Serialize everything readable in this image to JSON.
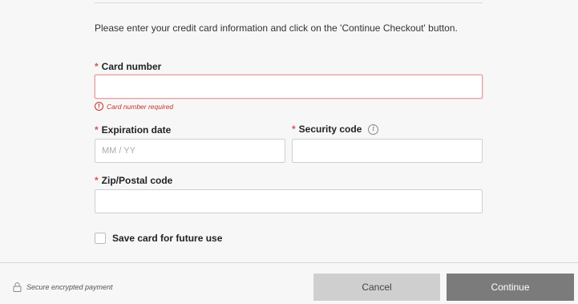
{
  "intro_text": "Please enter your credit card information and click on the 'Continue Checkout' button.",
  "required_marker": "*",
  "card_number": {
    "label": "Card number",
    "value": "",
    "error": "Card number required",
    "error_icon": "!"
  },
  "expiration": {
    "label": "Expiration date",
    "placeholder": "MM / YY",
    "value": ""
  },
  "security": {
    "label": "Security code",
    "info_icon": "i",
    "value": ""
  },
  "zip": {
    "label": "Zip/Postal code",
    "value": ""
  },
  "save_card": {
    "label": "Save card for future use",
    "checked": false
  },
  "footer": {
    "secure_text": "Secure encrypted payment",
    "cancel_label": "Cancel",
    "continue_label": "Continue"
  },
  "colors": {
    "error": "#c9302c",
    "continue_bg": "#7b7b7b",
    "cancel_bg": "#cfcfcf"
  }
}
